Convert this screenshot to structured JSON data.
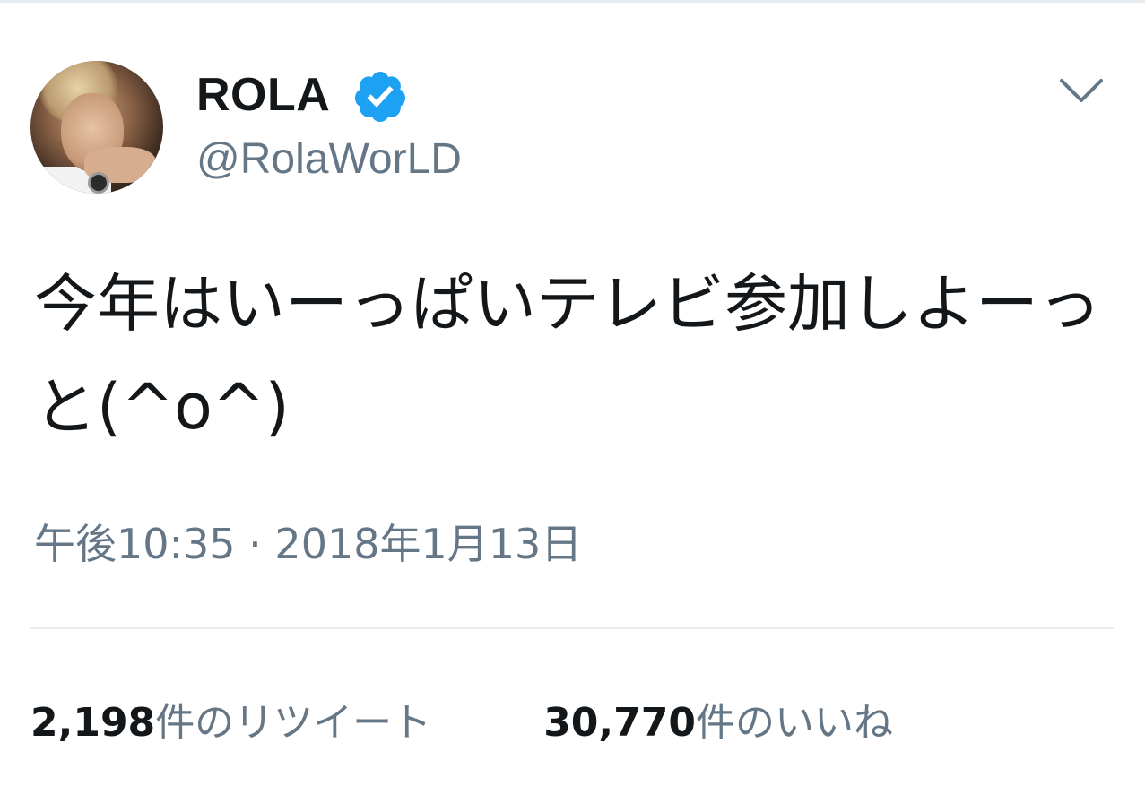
{
  "tweet": {
    "display_name": "ROLA",
    "handle": "@RolaWorLD",
    "verified": true,
    "text": "今年はいーっぱいテレビ参加しよーっと(^o^)",
    "timestamp": "午後10:35 · 2018年1月13日",
    "retweets": {
      "count": "2,198",
      "label": "件のリツイート"
    },
    "likes": {
      "count": "30,770",
      "label": "件のいいね"
    }
  },
  "icons": {
    "verified": "verified-badge-icon",
    "menu": "chevron-down-icon"
  },
  "colors": {
    "verified_blue": "#1da1f2",
    "secondary_text": "#657786",
    "primary_text": "#14171a",
    "divider": "#e6ecf0"
  }
}
